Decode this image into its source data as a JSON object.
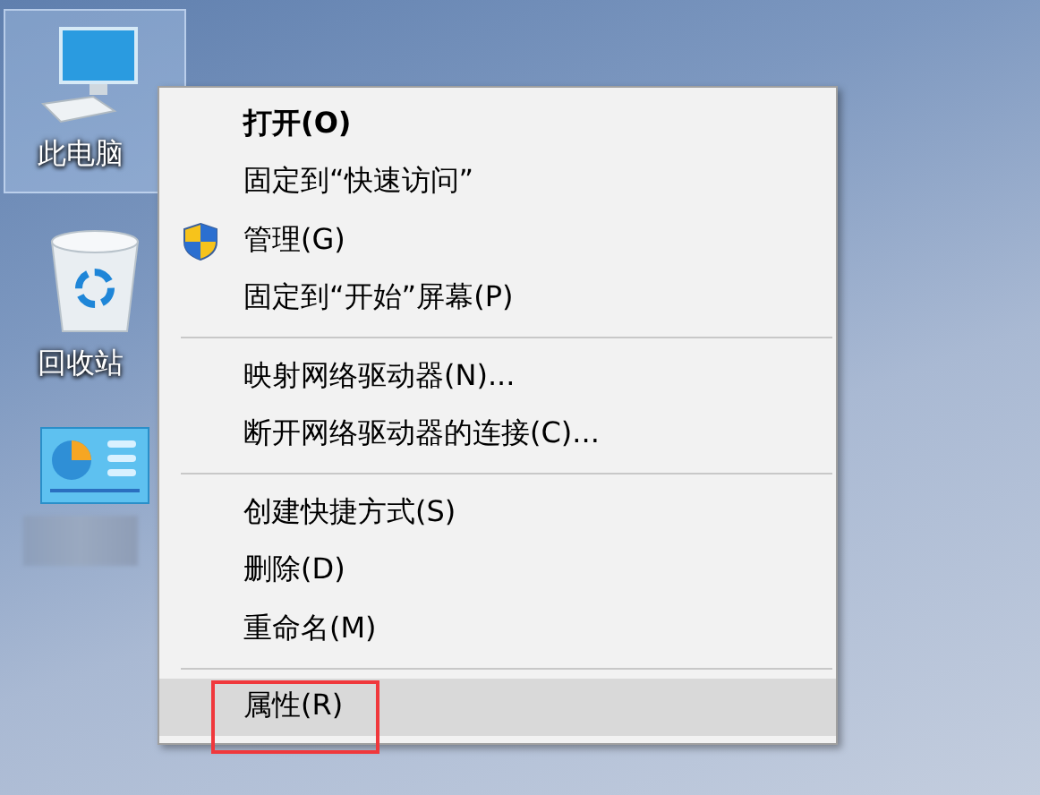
{
  "desktop_icons": [
    {
      "kind": "computer",
      "label": "此电脑",
      "selected": true
    },
    {
      "kind": "recycle-bin",
      "label": "回收站",
      "selected": false
    },
    {
      "kind": "control-panel",
      "selected": false
    }
  ],
  "context_menu": {
    "groups": [
      [
        {
          "label": "打开(O)",
          "bold": true,
          "selected": false,
          "kind": "plain"
        },
        {
          "label": "固定到“快速访问”",
          "bold": false,
          "selected": false,
          "kind": "plain"
        },
        {
          "label": "管理(G)",
          "bold": false,
          "selected": false,
          "kind": "shield"
        },
        {
          "label": "固定到“开始”屏幕(P)",
          "bold": false,
          "selected": false,
          "kind": "plain"
        }
      ],
      [
        {
          "label": "映射网络驱动器(N)...",
          "bold": false,
          "selected": false,
          "kind": "plain"
        },
        {
          "label": "断开网络驱动器的连接(C)...",
          "bold": false,
          "selected": false,
          "kind": "plain"
        }
      ],
      [
        {
          "label": "创建快捷方式(S)",
          "bold": false,
          "selected": false,
          "kind": "plain"
        },
        {
          "label": "删除(D)",
          "bold": false,
          "selected": false,
          "kind": "plain"
        },
        {
          "label": "重命名(M)",
          "bold": false,
          "selected": false,
          "kind": "plain"
        }
      ],
      [
        {
          "label": "属性(R)",
          "bold": false,
          "selected": true,
          "kind": "plain",
          "annotated": true
        }
      ]
    ]
  }
}
